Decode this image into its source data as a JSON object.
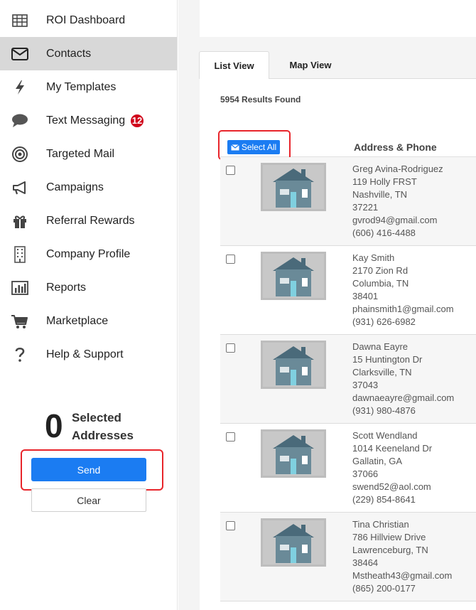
{
  "sidebar": {
    "items": [
      {
        "label": "ROI Dashboard",
        "icon": "grid-table-icon"
      },
      {
        "label": "Contacts",
        "icon": "envelope-icon",
        "active": true
      },
      {
        "label": "My Templates",
        "icon": "lightning-bolt-icon"
      },
      {
        "label": "Text Messaging",
        "icon": "chat-bubble-icon",
        "badge": "12"
      },
      {
        "label": "Targeted Mail",
        "icon": "target-icon"
      },
      {
        "label": "Campaigns",
        "icon": "megaphone-icon"
      },
      {
        "label": "Referral Rewards",
        "icon": "gift-icon"
      },
      {
        "label": "Company Profile",
        "icon": "building-icon"
      },
      {
        "label": "Reports",
        "icon": "bar-chart-icon"
      },
      {
        "label": "Marketplace",
        "icon": "shopping-cart-icon"
      },
      {
        "label": "Help & Support",
        "icon": "question-mark-icon"
      }
    ],
    "selected": {
      "count": "0",
      "label": "Selected Addresses"
    },
    "send_label": "Send",
    "clear_label": "Clear"
  },
  "main": {
    "tabs": [
      {
        "label": "List View",
        "active": true
      },
      {
        "label": "Map View",
        "active": false
      }
    ],
    "results_text": "5954 Results Found",
    "select_all_label": "Select All",
    "column_header": "Address & Phone",
    "rows": [
      {
        "name": "Greg Avina-Rodriguez",
        "street": "119 Holly FRST",
        "city": "Nashville, TN",
        "zip": "37221",
        "email": "gvrod94@gmail.com",
        "phone": "(606) 416-4488"
      },
      {
        "name": "Kay Smith",
        "street": "2170 Zion Rd",
        "city": "Columbia, TN",
        "zip": "38401",
        "email": "phainsmith1@gmail.com",
        "phone": "(931) 626-6982"
      },
      {
        "name": "Dawna Eayre",
        "street": "15 Huntington Dr",
        "city": "Clarksville, TN",
        "zip": "37043",
        "email": "dawnaeayre@gmail.com",
        "phone": "(931) 980-4876"
      },
      {
        "name": "Scott Wendland",
        "street": "1014 Keeneland Dr",
        "city": "Gallatin, GA",
        "zip": "37066",
        "email": "swend52@aol.com",
        "phone": "(229) 854-8641"
      },
      {
        "name": "Tina Christian",
        "street": "786 Hillview Drive",
        "city": "Lawrenceburg, TN",
        "zip": "38464",
        "email": "Mstheath43@gmail.com",
        "phone": "(865) 200-0177"
      }
    ]
  },
  "colors": {
    "accent": "#1b7cf2",
    "highlight": "#e8252b",
    "badge": "#d0021b",
    "active_nav": "#d8d8d8"
  }
}
